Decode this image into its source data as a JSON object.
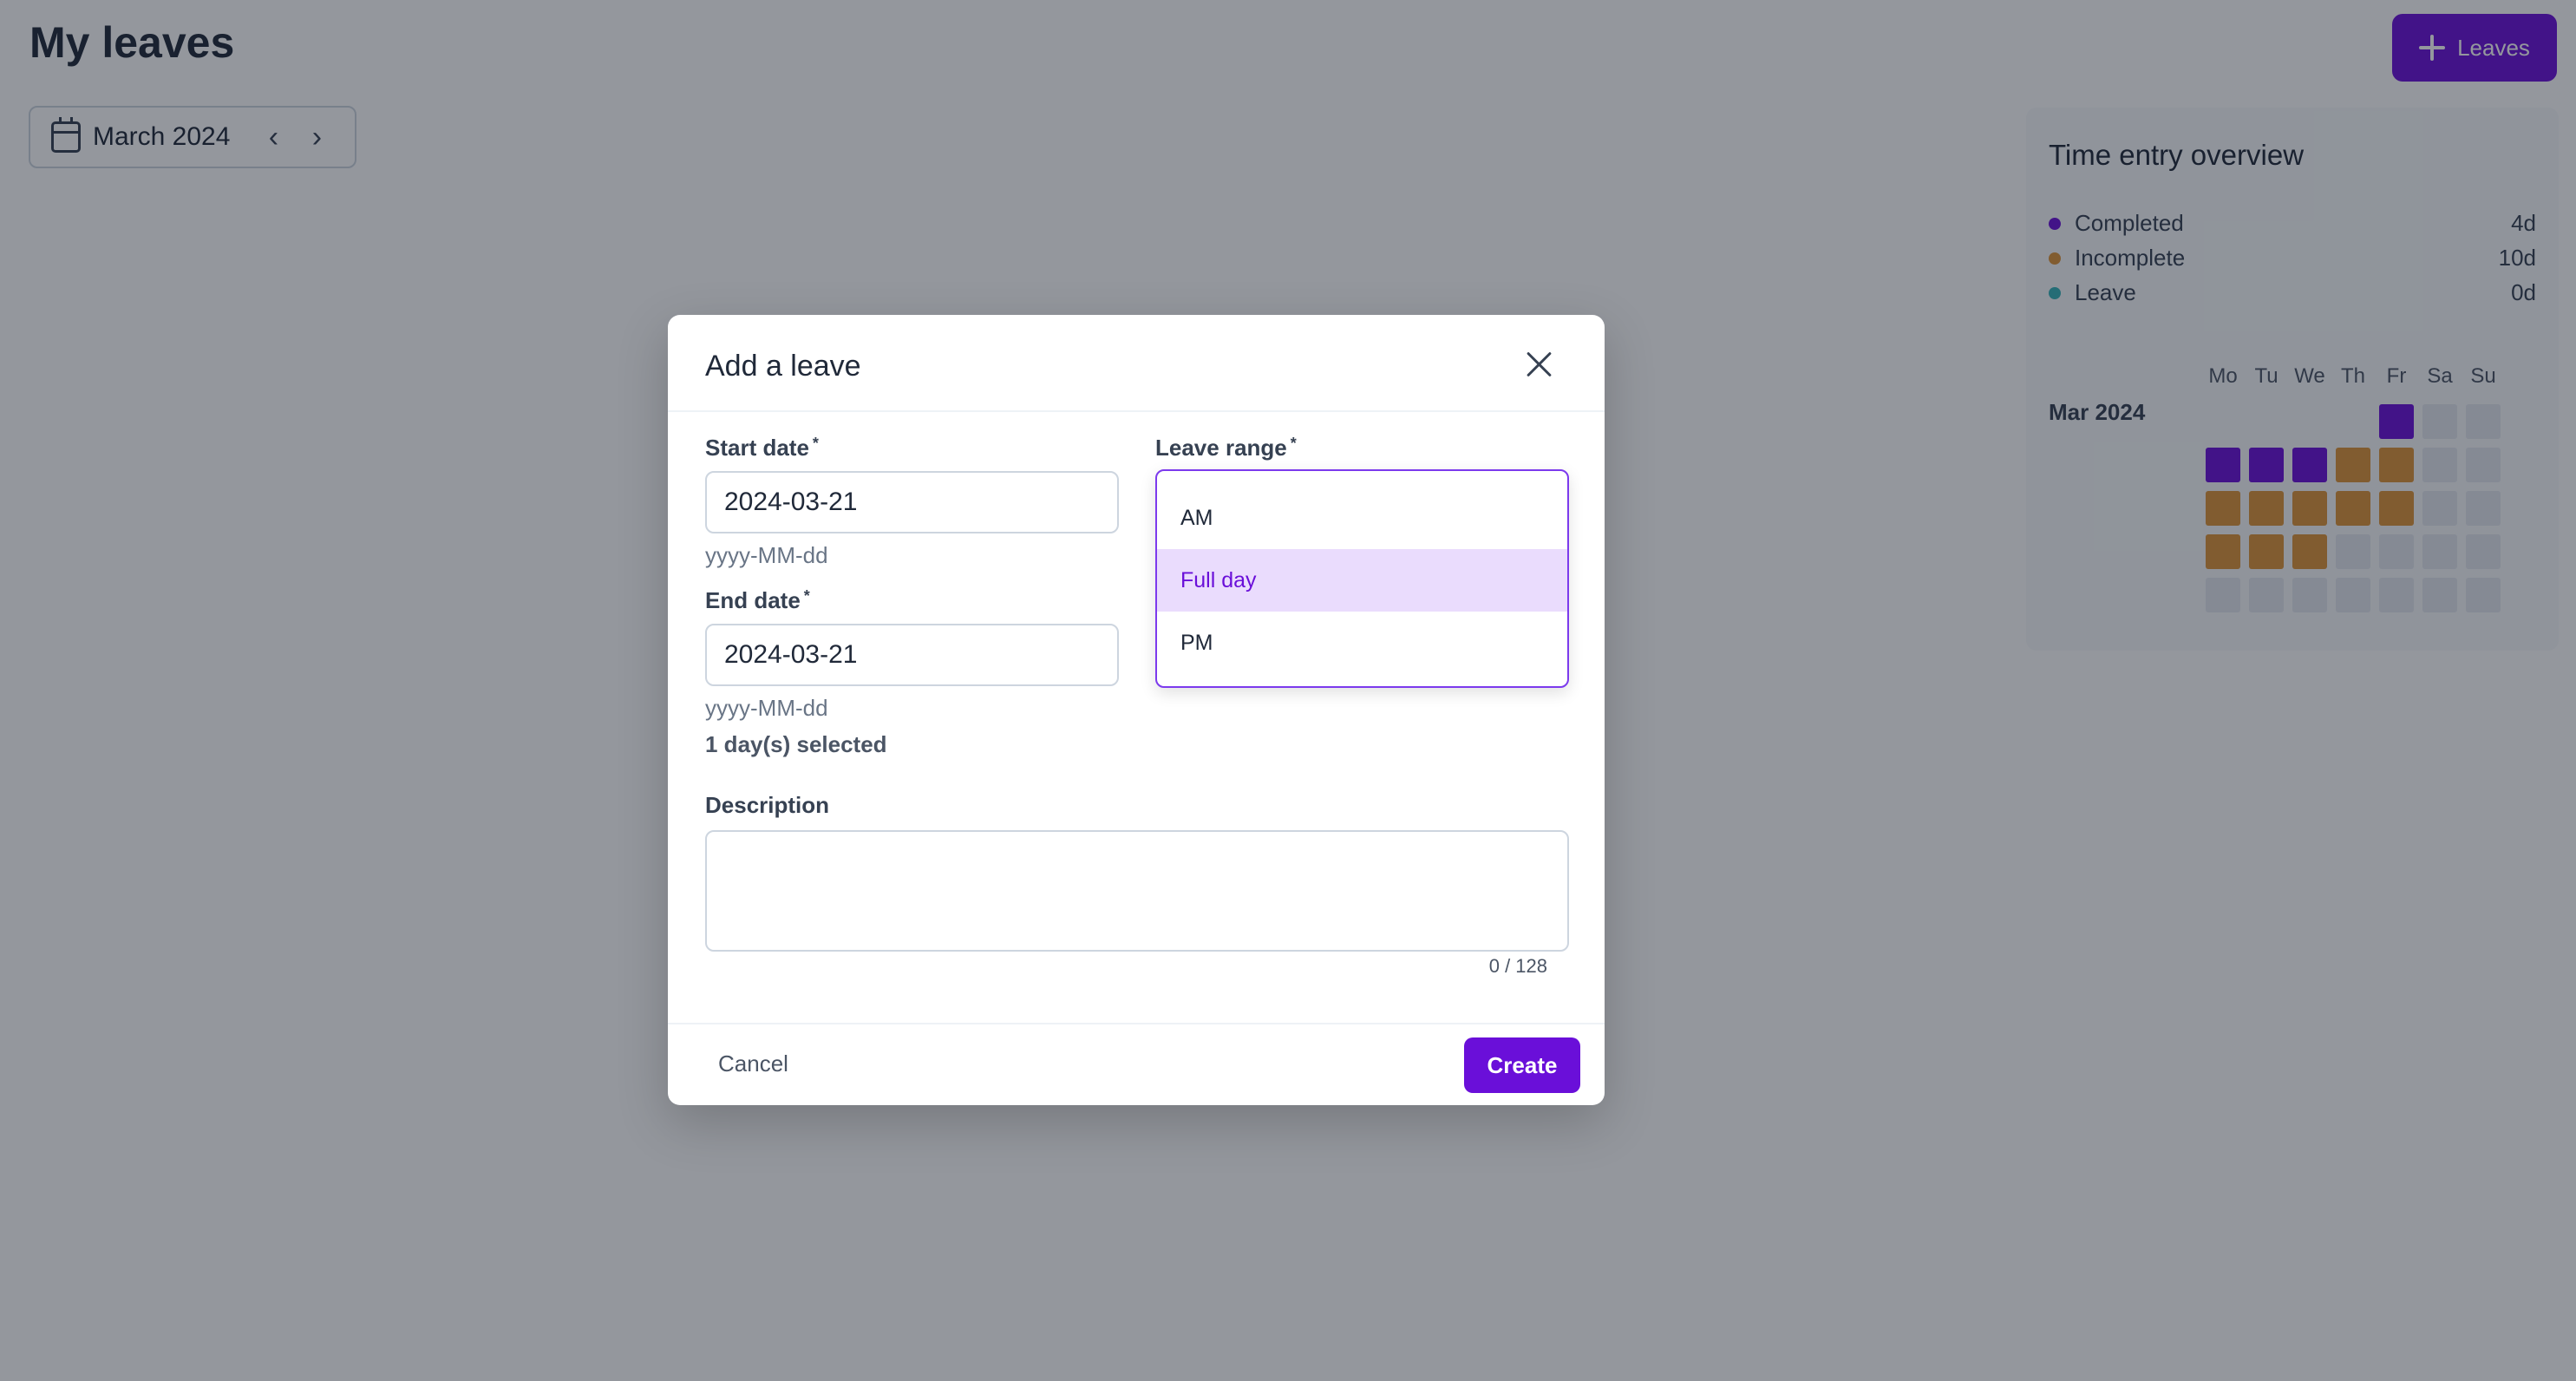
{
  "page": {
    "title": "My leaves",
    "add_button_label": "Leaves"
  },
  "month_picker": {
    "label": "March 2024",
    "prev_icon": "chevron-left-icon",
    "next_icon": "chevron-right-icon"
  },
  "overview": {
    "title": "Time entry overview",
    "legend": [
      {
        "label": "Completed",
        "value": "4d",
        "color": "#6a0fd9"
      },
      {
        "label": "Incomplete",
        "value": "10d",
        "color": "#dd9439"
      },
      {
        "label": "Leave",
        "value": "0d",
        "color": "#35b3b8"
      }
    ],
    "month_label": "Mar 2024",
    "weekdays": [
      "Mo",
      "Tu",
      "We",
      "Th",
      "Fr",
      "Sa",
      "Su"
    ],
    "weeks": [
      [
        "none",
        "none",
        "none",
        "none",
        "completed",
        "weekend",
        "weekend"
      ],
      [
        "completed",
        "completed",
        "completed",
        "incomplete",
        "incomplete",
        "weekend",
        "weekend"
      ],
      [
        "incomplete",
        "incomplete",
        "incomplete",
        "incomplete",
        "incomplete",
        "weekend",
        "weekend"
      ],
      [
        "incomplete",
        "incomplete",
        "incomplete",
        "empty",
        "empty",
        "weekend",
        "weekend"
      ],
      [
        "empty",
        "empty",
        "empty",
        "empty",
        "empty",
        "weekend",
        "weekend"
      ]
    ],
    "cell_colors": {
      "completed": "#6a0fd9",
      "incomplete": "#dd9439",
      "empty": "#e3e8ef",
      "weekend": "#e3e8ef"
    }
  },
  "modal": {
    "title": "Add a leave",
    "start_date": {
      "label": "Start date",
      "value": "2024-03-21",
      "hint": "yyyy-MM-dd"
    },
    "end_date": {
      "label": "End date",
      "value": "2024-03-21",
      "hint": "yyyy-MM-dd"
    },
    "days_selected": "1 day(s) selected",
    "leave_range": {
      "label": "Leave range",
      "options": [
        "AM",
        "Full day",
        "PM"
      ],
      "selected": "Full day"
    },
    "description": {
      "label": "Description",
      "value": "",
      "counter": "0 / 128"
    },
    "cancel_label": "Cancel",
    "create_label": "Create"
  }
}
